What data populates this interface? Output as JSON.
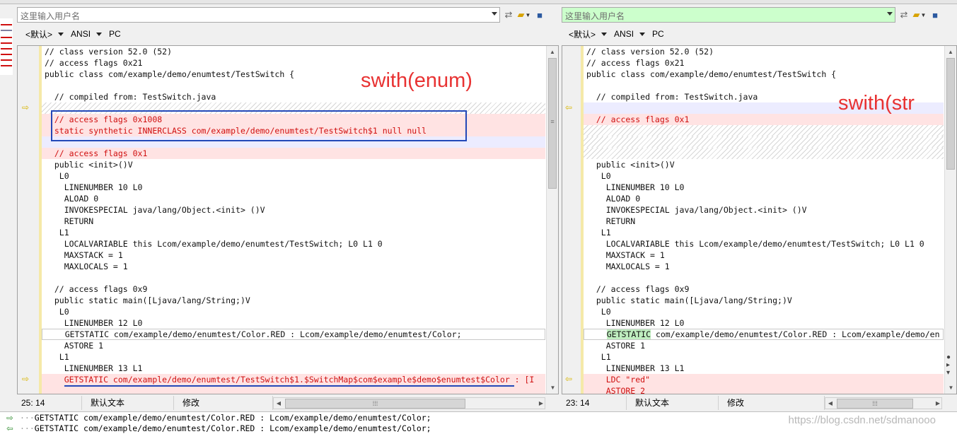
{
  "left": {
    "path_placeholder": "这里输入用户名",
    "encoding": {
      "lineend": "<默认>",
      "charset": "ANSI",
      "platform": "PC"
    },
    "status": {
      "position": "25: 14",
      "mode": "默认文本",
      "state": "修改"
    },
    "annotation": "swith(enum)",
    "lines": [
      {
        "t": "// class version 52.0 (52)",
        "k": ""
      },
      {
        "t": "// access flags 0x21",
        "k": ""
      },
      {
        "t": "public class com/example/demo/enumtest/TestSwitch {",
        "k": ""
      },
      {
        "t": "",
        "k": ""
      },
      {
        "t": "  // compiled from: TestSwitch.java",
        "k": ""
      },
      {
        "t": "",
        "k": "hatch"
      },
      {
        "t": "  // access flags 0x1008",
        "k": "del"
      },
      {
        "t": "  static synthetic INNERCLASS com/example/demo/enumtest/TestSwitch$1 null null",
        "k": "del"
      },
      {
        "t": "",
        "k": "blue"
      },
      {
        "t": "  // access flags 0x1",
        "k": "del"
      },
      {
        "t": "  public <init>()V",
        "k": ""
      },
      {
        "t": "   L0",
        "k": ""
      },
      {
        "t": "    LINENUMBER 10 L0",
        "k": ""
      },
      {
        "t": "    ALOAD 0",
        "k": ""
      },
      {
        "t": "    INVOKESPECIAL java/lang/Object.<init> ()V",
        "k": ""
      },
      {
        "t": "    RETURN",
        "k": ""
      },
      {
        "t": "   L1",
        "k": ""
      },
      {
        "t": "    LOCALVARIABLE this Lcom/example/demo/enumtest/TestSwitch; L0 L1 0",
        "k": ""
      },
      {
        "t": "    MAXSTACK = 1",
        "k": ""
      },
      {
        "t": "    MAXLOCALS = 1",
        "k": ""
      },
      {
        "t": "",
        "k": ""
      },
      {
        "t": "  // access flags 0x9",
        "k": ""
      },
      {
        "t": "  public static main([Ljava/lang/String;)V",
        "k": ""
      },
      {
        "t": "   L0",
        "k": ""
      },
      {
        "t": "    LINENUMBER 12 L0",
        "k": ""
      },
      {
        "t": "    GETSTATIC com/example/demo/enumtest/Color.RED : Lcom/example/demo/enumtest/Color;",
        "k": "cur"
      },
      {
        "t": "    ASTORE 1",
        "k": ""
      },
      {
        "t": "   L1",
        "k": ""
      },
      {
        "t": "    LINENUMBER 13 L1",
        "k": ""
      },
      {
        "t": "    GETSTATIC com/example/demo/enumtest/TestSwitch$1.$SwitchMap$com$example$demo$enumtest$Color : [I",
        "k": "del"
      },
      {
        "t": "",
        "k": "del"
      }
    ]
  },
  "right": {
    "path_placeholder": "这里输入用户名",
    "encoding": {
      "lineend": "<默认>",
      "charset": "ANSI",
      "platform": "PC"
    },
    "status": {
      "position": "23: 14",
      "mode": "默认文本",
      "state": "修改"
    },
    "annotation": "swith(str",
    "lines": [
      {
        "t": "// class version 52.0 (52)",
        "k": ""
      },
      {
        "t": "// access flags 0x21",
        "k": ""
      },
      {
        "t": "public class com/example/demo/enumtest/TestSwitch {",
        "k": ""
      },
      {
        "t": "",
        "k": ""
      },
      {
        "t": "  // compiled from: TestSwitch.java",
        "k": ""
      },
      {
        "t": "",
        "k": "blue"
      },
      {
        "t": "  // access flags 0x1",
        "k": "del"
      },
      {
        "t": "",
        "k": "hatch"
      },
      {
        "t": "",
        "k": "hatch"
      },
      {
        "t": "",
        "k": "hatch"
      },
      {
        "t": "  public <init>()V",
        "k": ""
      },
      {
        "t": "   L0",
        "k": ""
      },
      {
        "t": "    LINENUMBER 10 L0",
        "k": ""
      },
      {
        "t": "    ALOAD 0",
        "k": ""
      },
      {
        "t": "    INVOKESPECIAL java/lang/Object.<init> ()V",
        "k": ""
      },
      {
        "t": "    RETURN",
        "k": ""
      },
      {
        "t": "   L1",
        "k": ""
      },
      {
        "t": "    LOCALVARIABLE this Lcom/example/demo/enumtest/TestSwitch; L0 L1 0",
        "k": ""
      },
      {
        "t": "    MAXSTACK = 1",
        "k": ""
      },
      {
        "t": "    MAXLOCALS = 1",
        "k": ""
      },
      {
        "t": "",
        "k": ""
      },
      {
        "t": "  // access flags 0x9",
        "k": ""
      },
      {
        "t": "  public static main([Ljava/lang/String;)V",
        "k": ""
      },
      {
        "t": "   L0",
        "k": ""
      },
      {
        "t": "    LINENUMBER 12 L0",
        "k": ""
      },
      {
        "t": "    GETSTATIC com/example/demo/enumtest/Color.RED : Lcom/example/demo/en",
        "k": "cur"
      },
      {
        "t": "    ASTORE 1",
        "k": ""
      },
      {
        "t": "   L1",
        "k": ""
      },
      {
        "t": "    LINENUMBER 13 L1",
        "k": ""
      },
      {
        "t": "    LDC \"red\"",
        "k": "del"
      },
      {
        "t": "    ASTORE 2",
        "k": "del"
      }
    ]
  },
  "bottom": {
    "line1": "GETSTATIC com/example/demo/enumtest/Color.RED : Lcom/example/demo/enumtest/Color;",
    "line2": "GETSTATIC com/example/demo/enumtest/Color.RED : Lcom/example/demo/enumtest/Color;",
    "watermark": "https://blog.csdn.net/sdmanooo"
  },
  "colors": {
    "deleted_bg": "#ffe3e3",
    "deleted_text": "#d01010",
    "annotation": "#e83232",
    "box": "#2348b8"
  }
}
